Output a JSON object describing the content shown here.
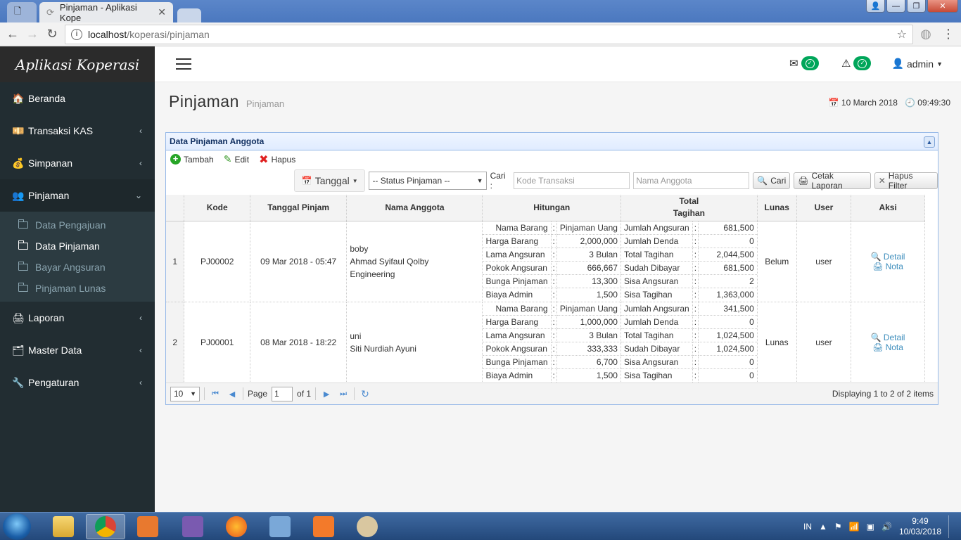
{
  "browser": {
    "tab_title": "Pinjaman - Aplikasi Kope",
    "url_host": "localhost",
    "url_path": "/koperasi/pinjaman"
  },
  "sidebar": {
    "brand": "Aplikasi Koperasi",
    "items": [
      {
        "label": "Beranda",
        "icon": "home-icon"
      },
      {
        "label": "Transaksi KAS",
        "icon": "money-icon"
      },
      {
        "label": "Simpanan",
        "icon": "savings-icon"
      },
      {
        "label": "Pinjaman",
        "icon": "people-icon"
      },
      {
        "label": "Laporan",
        "icon": "report-icon"
      },
      {
        "label": "Master Data",
        "icon": "database-icon"
      },
      {
        "label": "Pengaturan",
        "icon": "wrench-icon"
      }
    ],
    "submenu": [
      "Data Pengajuan",
      "Data Pinjaman",
      "Bayar Angsuran",
      "Pinjaman Lunas"
    ]
  },
  "header": {
    "user": "admin"
  },
  "page": {
    "title": "Pinjaman",
    "subtitle": "Pinjaman",
    "date": "10 March 2018",
    "time": "09:49:30"
  },
  "panel": {
    "title": "Data Pinjaman Anggota",
    "btn_add": "Tambah",
    "btn_edit": "Edit",
    "btn_delete": "Hapus",
    "btn_tanggal": "Tanggal",
    "status_select": "-- Status Pinjaman --",
    "search_label": "Cari :",
    "ph_kode": "Kode Transaksi",
    "ph_nama": "Nama Anggota",
    "btn_cari": "Cari",
    "btn_cetak": "Cetak Laporan",
    "btn_hapus_filter": "Hapus Filter"
  },
  "table": {
    "headers": {
      "kode": "Kode",
      "tanggal": "Tanggal Pinjam",
      "nama": "Nama Anggota",
      "hitungan": "Hitungan",
      "total_1": "Total",
      "total_2": "Tagihan",
      "lunas": "Lunas",
      "user": "User",
      "aksi": "Aksi"
    },
    "labels": {
      "nama_barang": "Nama Barang",
      "harga_barang": "Harga Barang",
      "lama_angsuran": "Lama Angsuran",
      "pokok_angsuran": "Pokok Angsuran",
      "bunga_pinjaman": "Bunga Pinjaman",
      "biaya_admin": "Biaya Admin",
      "jumlah_angsuran": "Jumlah Angsuran",
      "jumlah_denda": "Jumlah Denda",
      "total_tagihan": "Total Tagihan",
      "sudah_dibayar": "Sudah Dibayar",
      "sisa_angsuran": "Sisa Angsuran",
      "sisa_tagihan": "Sisa Tagihan",
      "colon": ":",
      "detail": "Detail",
      "nota": "Nota"
    },
    "rows": [
      {
        "no": "1",
        "kode": "PJ00002",
        "tanggal": "09 Mar 2018 - 05:47",
        "nama_1": "boby",
        "nama_2": "Ahmad Syifaul Qolby",
        "nama_3": "Engineering",
        "nama_barang": "Pinjaman Uang",
        "harga_barang": "2,000,000",
        "lama_angsuran": "3 Bulan",
        "pokok_angsuran": "666,667",
        "bunga_pinjaman": "13,300",
        "biaya_admin": "1,500",
        "jumlah_angsuran": "681,500",
        "jumlah_denda": "0",
        "total_tagihan": "2,044,500",
        "sudah_dibayar": "681,500",
        "sisa_angsuran": "2",
        "sisa_tagihan": "1,363,000",
        "lunas": "Belum",
        "user": "user"
      },
      {
        "no": "2",
        "kode": "PJ00001",
        "tanggal": "08 Mar 2018 - 18:22",
        "nama_1": "uni",
        "nama_2": "Siti Nurdiah Ayuni",
        "nama_3": "",
        "nama_barang": "Pinjaman Uang",
        "harga_barang": "1,000,000",
        "lama_angsuran": "3 Bulan",
        "pokok_angsuran": "333,333",
        "bunga_pinjaman": "6,700",
        "biaya_admin": "1,500",
        "jumlah_angsuran": "341,500",
        "jumlah_denda": "0",
        "total_tagihan": "1,024,500",
        "sudah_dibayar": "1,024,500",
        "sisa_angsuran": "0",
        "sisa_tagihan": "0",
        "lunas": "Lunas",
        "user": "user"
      }
    ]
  },
  "pager": {
    "page_size": "10",
    "page_label": "Page",
    "page_value": "1",
    "of_label": "of 1",
    "info": "Displaying 1 to 2 of 2 items"
  },
  "taskbar": {
    "lang": "IN",
    "time": "9:49",
    "date": "10/03/2018"
  }
}
